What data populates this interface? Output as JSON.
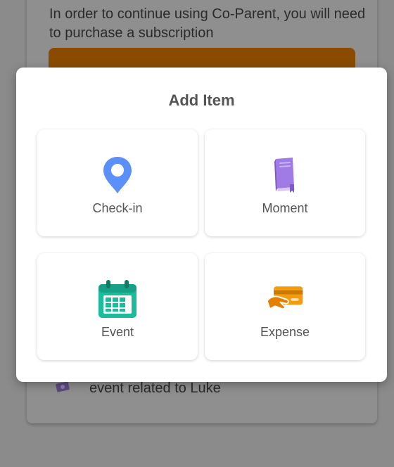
{
  "background": {
    "subscription_text": "In order to continue using Co-Parent, you will need to purchase a subscription",
    "cta_color": "#8a4b00",
    "event_row": {
      "text": "event related to Luke",
      "icon": "money-icon"
    }
  },
  "modal": {
    "title": "Add Item",
    "items": [
      {
        "label": "Check-in",
        "icon": "location-pin-icon",
        "color": "#5b8ff9"
      },
      {
        "label": "Moment",
        "icon": "book-icon",
        "color": "#a07be6"
      },
      {
        "label": "Event",
        "icon": "calendar-icon",
        "color": "#1abc9c"
      },
      {
        "label": "Expense",
        "icon": "credit-card-icon",
        "color": "#f39c12"
      }
    ]
  }
}
